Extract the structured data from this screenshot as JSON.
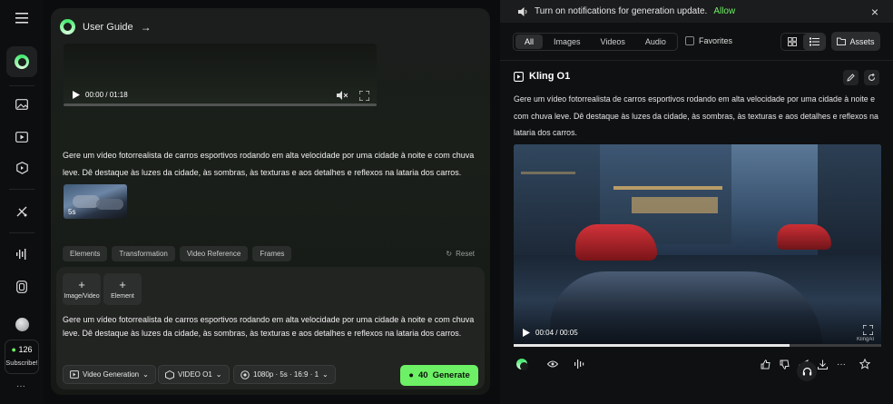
{
  "rail": {
    "items": [
      "menu-icon",
      "kling-logo",
      "image-icon",
      "video-icon",
      "element-icon",
      "restyle-icon",
      "audio-icon",
      "tool-icon",
      "avatar"
    ],
    "credits": "126",
    "subscribe": "Subscribe!",
    "more": "···"
  },
  "guide": {
    "title": "User Guide",
    "video_time": "00:00 / 01:18"
  },
  "main": {
    "prompt": "Gere um vídeo fotorrealista de carros esportivos rodando em alta velocidade por uma cidade à noite e com chuva leve. Dê destaque às luzes da cidade, às sombras, às texturas e aos detalhes e reflexos na lataria dos carros.",
    "thumb_label": "5s",
    "chips": [
      "Elements",
      "Transformation",
      "Video Reference",
      "Frames"
    ],
    "reset": "Reset"
  },
  "composer": {
    "tiles": [
      "Image/Video",
      "Element"
    ],
    "prompt": "Gere um vídeo fotorrealista de carros esportivos rodando em alta velocidade por uma cidade à noite e com chuva leve. Dê destaque às luzes da cidade, às sombras, às texturas e aos detalhes e reflexos na lataria dos carros.",
    "mode": "Video Generation",
    "model": "VIDEO O1",
    "settings": "1080p · 5s · 16:9 · 1",
    "cost": "40",
    "generate": "Generate"
  },
  "notice": {
    "text": "Turn on notifications for generation update.",
    "action": "Allow"
  },
  "filters": {
    "tabs": [
      "All",
      "Images",
      "Videos",
      "Audio"
    ],
    "active": "All",
    "favorites": "Favorites",
    "assets": "Assets"
  },
  "result": {
    "title": "Kling O1",
    "prompt": "Gere um vídeo fotorrealista de carros esportivos rodando em alta velocidade por uma cidade à noite e com chuva leve. Dê destaque às luzes da cidade, às sombras, às texturas e aos detalhes e reflexos na lataria dos carros.",
    "time": "00:04 / 00:05",
    "watermark": "KlingAI",
    "progress": 0.75
  },
  "colors": {
    "accent": "#6df065",
    "panel": "#1b1e1c",
    "background": "#0b0c0d"
  }
}
